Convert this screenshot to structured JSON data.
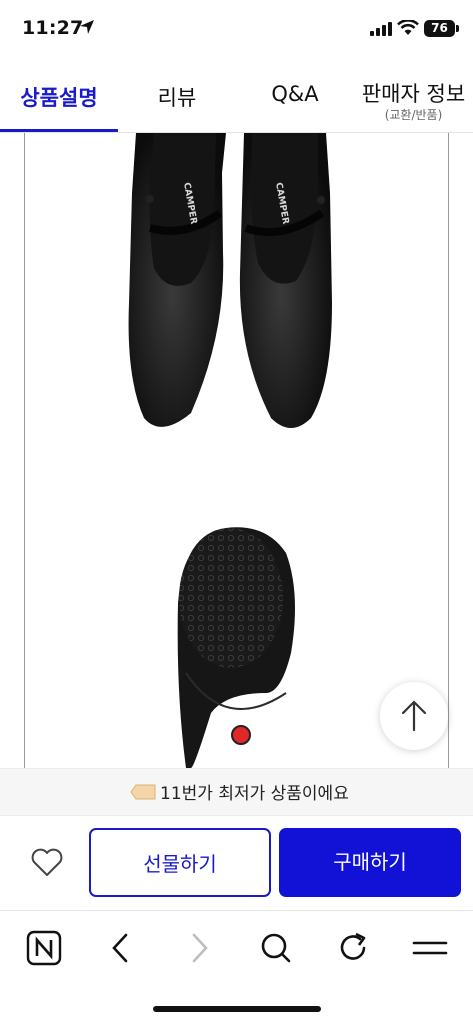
{
  "status": {
    "time": "11:27",
    "battery": "76"
  },
  "tabs": [
    {
      "label": "상품설명",
      "active": true
    },
    {
      "label": "리뷰"
    },
    {
      "label": "Q&A"
    },
    {
      "label": "판매자 정보",
      "sub": "(교환/반품)"
    }
  ],
  "product_image": {
    "brand_text": "CAMPER"
  },
  "promo": {
    "text": "11번가 최저가 상품이에요"
  },
  "actions": {
    "gift": "선물하기",
    "buy": "구매하기"
  },
  "colors": {
    "accent": "#1a1acb",
    "buy": "#1212d6"
  },
  "icons": [
    "location-arrow-icon",
    "signal-icon",
    "wifi-icon",
    "tag-icon",
    "heart-icon",
    "scroll-to-top-icon",
    "naver-home-icon",
    "back-icon",
    "forward-icon",
    "search-icon",
    "refresh-icon",
    "menu-icon"
  ]
}
